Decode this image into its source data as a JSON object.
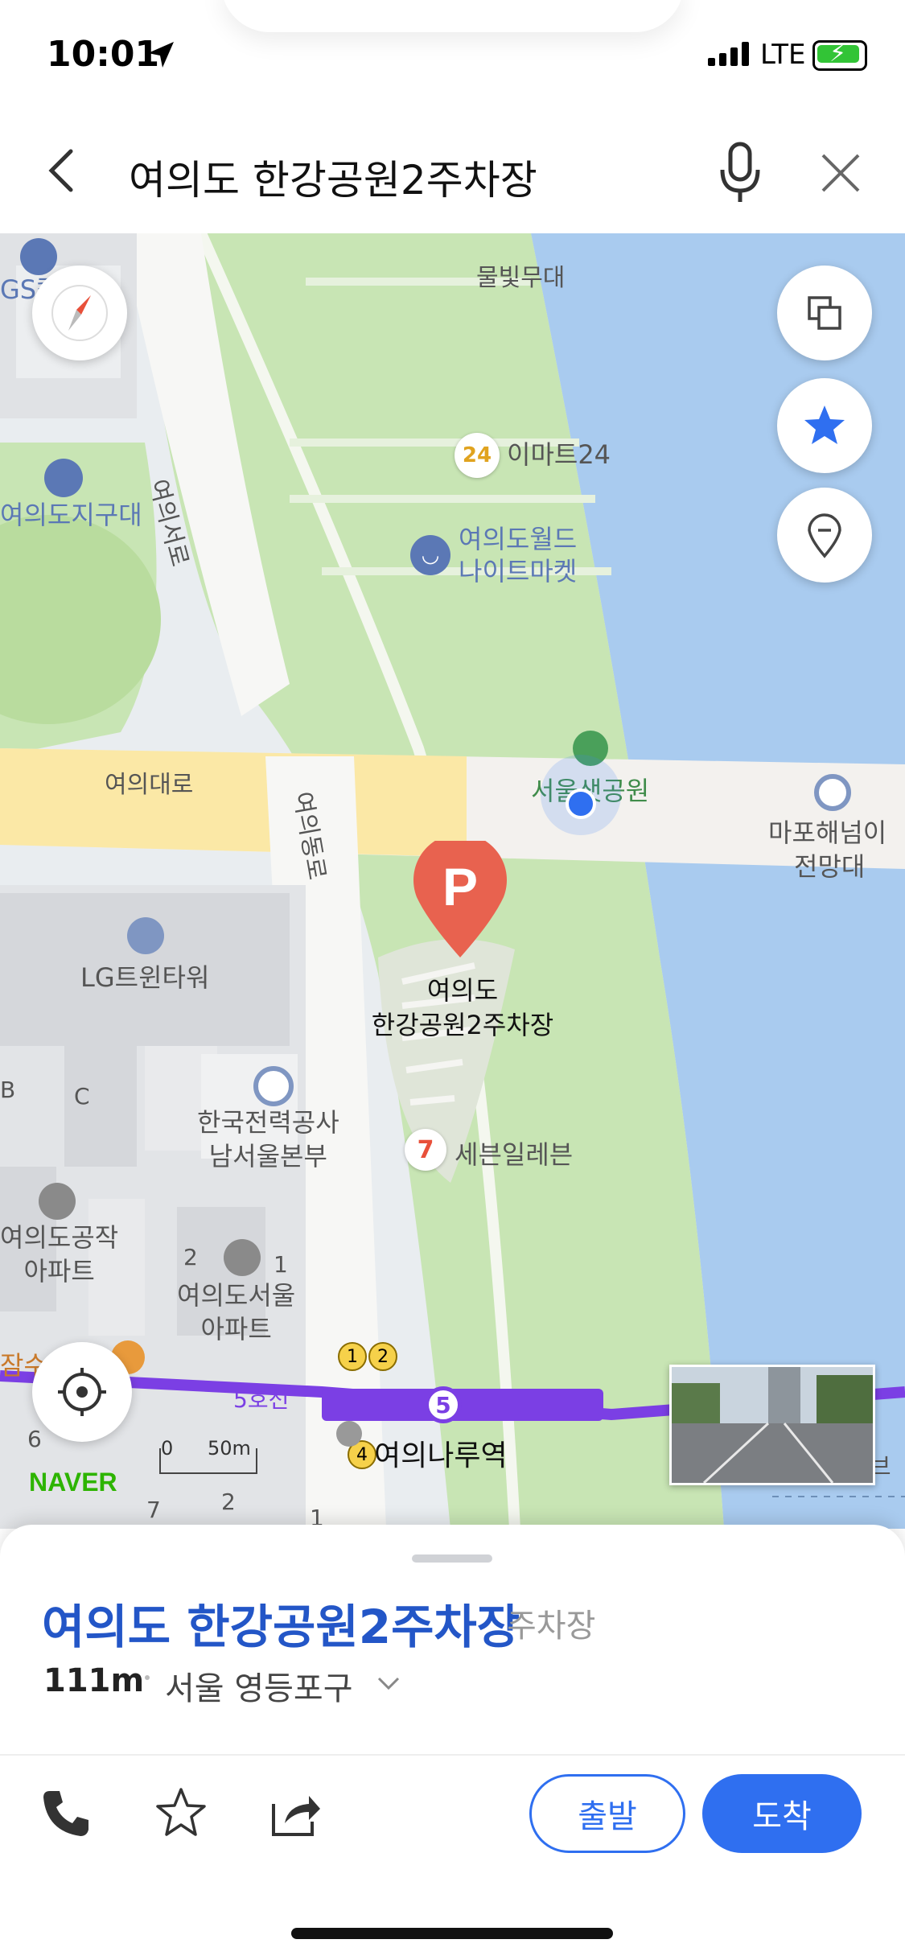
{
  "status_bar": {
    "time": "10:01",
    "network": "LTE"
  },
  "search": {
    "query": "여의도 한강공원2주차장"
  },
  "map": {
    "labels": {
      "mulbit": "물빛무대",
      "emart24": "이마트24",
      "emart_badge": "24",
      "night_market_line1": "여의도월드",
      "night_market_line2": "나이트마켓",
      "yeouiseoro": "여의서로",
      "jigudae": "여의도지구대",
      "gs_partial": "GS칼",
      "yeouidaero": "여의대로",
      "yeouidongro": "여의동로",
      "saetgang_park": "서울샛공원",
      "mapo_line1": "마포해넘이",
      "mapo_line2": "전망대",
      "lg_twin": "LG트윈타워",
      "parking_line1": "여의도",
      "parking_line2": "한강공원2주차장",
      "parking_letter": "P",
      "kepco_line1": "한국전력공사",
      "kepco_line2": "남서울본부",
      "seven_eleven": "세븐일레븐",
      "gongjak_line1": "여의도공작",
      "gongjak_line2": "아파트",
      "seoul_apt_line1": "여의도서울",
      "seoul_apt_line2": "아파트",
      "jamsu_partial": "잠수",
      "line5": "5호선",
      "line5_badge": "5",
      "naru_station": "여의나루역",
      "exit1": "1",
      "exit2": "2",
      "exit4": "4",
      "block_b": "B",
      "block_c": "C",
      "num_2a": "2",
      "num_1a": "1",
      "num_6": "6",
      "num_7": "7",
      "num_2b": "2",
      "num_1b": "1",
      "partial_bu": "브"
    },
    "scale": {
      "zero": "0",
      "distance": "50m"
    },
    "brand": "NAVER"
  },
  "place": {
    "name": "여의도 한강공원2주차장",
    "category": "주차장",
    "distance": "111m",
    "region": "서울 영등포구"
  },
  "actions": {
    "depart": "출발",
    "arrive": "도착"
  },
  "colors": {
    "accent": "#2f6ff0",
    "place_name": "#2356c7",
    "water": "#a9cbef",
    "park": "#c5e3b1",
    "road_major": "#fbe8a6",
    "metro_line5": "#7b3fe4",
    "parking_marker": "#e8624f",
    "battery": "#32c436"
  },
  "icons": [
    "location-arrow-icon",
    "back-icon",
    "mic-icon",
    "close-icon",
    "compass-icon",
    "layers-icon",
    "favorites-star-icon",
    "pin-icon",
    "my-location-icon",
    "phone-icon",
    "star-outline-icon",
    "share-icon",
    "chevron-down-icon"
  ]
}
